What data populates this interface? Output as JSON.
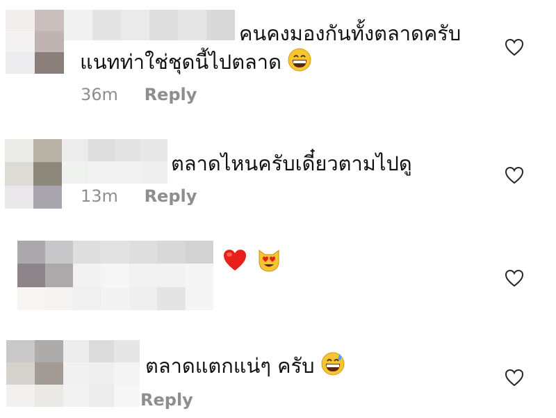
{
  "comments": [
    {
      "lines": [
        "คนคงมองกันทั้งตลาดครับ",
        "แนทท่าใช่ชุดนี้ไปตลาด"
      ],
      "emoji": "grinning-face-with-smiling-eyes",
      "time": "36m",
      "reply": "Reply",
      "like_icon": "heart-outline-icon"
    },
    {
      "lines": [
        "ตลาดไหนครับเดี๋ยวตามไปดู"
      ],
      "time": "13m",
      "reply": "Reply",
      "like_icon": "heart-outline-icon"
    },
    {
      "lines": [],
      "emojis": [
        "red-heart",
        "smiling-cat-heart-eyes"
      ],
      "like_icon": "heart-outline-icon"
    },
    {
      "lines": [
        "ตลาดแตกแน่ๆ ครับ"
      ],
      "emoji": "grinning-face-with-sweat",
      "reply": "Reply",
      "like_icon": "heart-outline-icon"
    }
  ],
  "colors": {
    "meta_gray": "#8e8e8e",
    "text": "#111111",
    "heart_stroke": "#262626",
    "emoji_yellow": "#f7c531",
    "red_heart": "#e8201c"
  }
}
